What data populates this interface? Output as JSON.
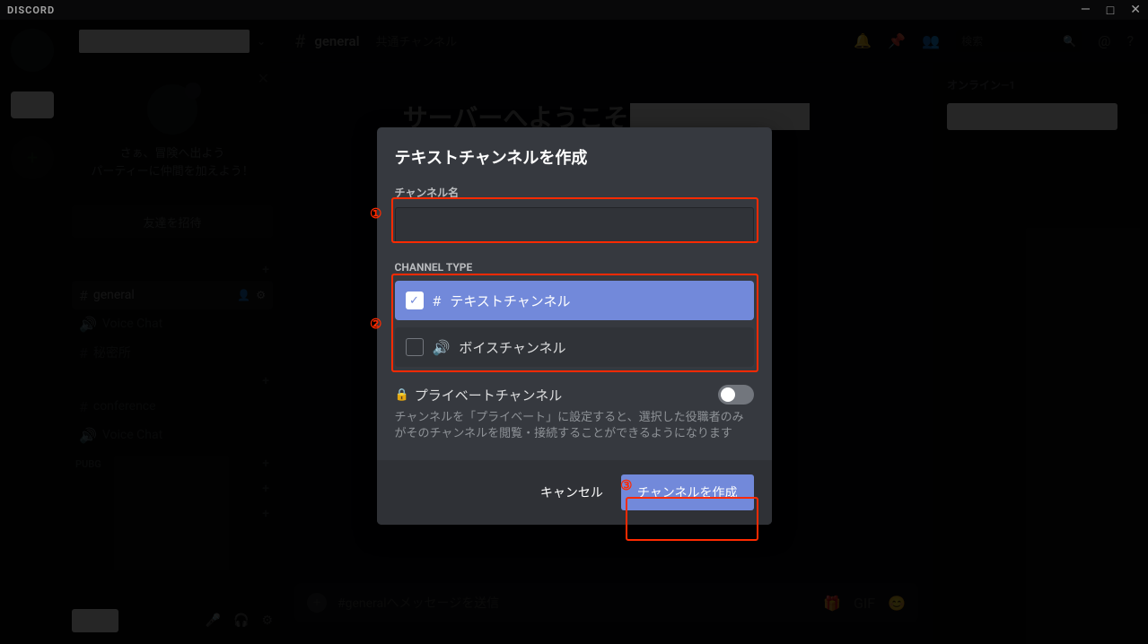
{
  "titlebar": {
    "logo": "DISCORD"
  },
  "dm_label": "",
  "channel_header": {
    "name": "general",
    "topic": "共通チャンネル"
  },
  "header_search_placeholder": "検索",
  "welcome": {
    "line1": "さぁ、冒険へ出よう",
    "line2": "パーティーに仲間を加えよう！",
    "invite": "友達を招待"
  },
  "categories": [
    {
      "name": "",
      "items": [
        {
          "prefix": "#",
          "label": "general",
          "selected": true
        },
        {
          "prefix": "🔊",
          "label": "Voice Chat"
        },
        {
          "prefix": "#",
          "label": "秘密所"
        }
      ]
    },
    {
      "name": "",
      "items": [
        {
          "prefix": "#",
          "label": "conference"
        },
        {
          "prefix": "🔊",
          "label": "Voice Chat"
        }
      ]
    },
    {
      "name": "PUBG",
      "items": []
    },
    {
      "name": "",
      "items": []
    },
    {
      "name": "",
      "items": []
    }
  ],
  "chat_welcome_prefix": "サーバーへようこそ",
  "chat_input_placeholder": "#generalへメッセージを送信",
  "members_header": "オンライン—1",
  "modal": {
    "title": "テキストチャンネルを作成",
    "name_label": "チャンネル名",
    "type_label": "CHANNEL TYPE",
    "type_text": "テキストチャンネル",
    "type_voice": "ボイスチャンネル",
    "private_title": "プライベートチャンネル",
    "private_desc": "チャンネルを「プライベート」に設定すると、選択した役職者のみがそのチャンネルを閲覧・接続することができるようになります",
    "cancel": "キャンセル",
    "create": "チャンネルを作成"
  },
  "annotations": {
    "1": "①",
    "2": "②",
    "3": "③"
  }
}
